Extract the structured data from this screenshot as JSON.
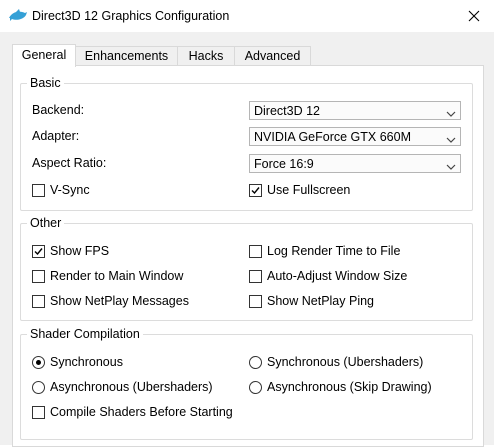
{
  "window": {
    "title": "Direct3D 12 Graphics Configuration",
    "app_icon": "dolphin-icon",
    "close_icon": "close-icon"
  },
  "tabs": [
    {
      "label": "General",
      "active": true
    },
    {
      "label": "Enhancements",
      "active": false
    },
    {
      "label": "Hacks",
      "active": false
    },
    {
      "label": "Advanced",
      "active": false
    }
  ],
  "basic": {
    "title": "Basic",
    "backend_label": "Backend:",
    "backend_value": "Direct3D 12",
    "adapter_label": "Adapter:",
    "adapter_value": "NVIDIA GeForce GTX 660M",
    "aspect_label": "Aspect Ratio:",
    "aspect_value": "Force 16:9",
    "vsync_label": "V-Sync",
    "vsync_checked": false,
    "fullscreen_label": "Use Fullscreen",
    "fullscreen_checked": true
  },
  "other": {
    "title": "Other",
    "items": [
      {
        "label": "Show FPS",
        "checked": true
      },
      {
        "label": "Log Render Time to File",
        "checked": false
      },
      {
        "label": "Render to Main Window",
        "checked": false
      },
      {
        "label": "Auto-Adjust Window Size",
        "checked": false
      },
      {
        "label": "Show NetPlay Messages",
        "checked": false
      },
      {
        "label": "Show NetPlay Ping",
        "checked": false
      }
    ]
  },
  "shader": {
    "title": "Shader Compilation",
    "options": [
      {
        "label": "Synchronous",
        "selected": true
      },
      {
        "label": "Synchronous (Ubershaders)",
        "selected": false
      },
      {
        "label": "Asynchronous (Ubershaders)",
        "selected": false
      },
      {
        "label": "Asynchronous (Skip Drawing)",
        "selected": false
      }
    ],
    "compile_before_label": "Compile Shaders Before Starting",
    "compile_before_checked": false
  }
}
